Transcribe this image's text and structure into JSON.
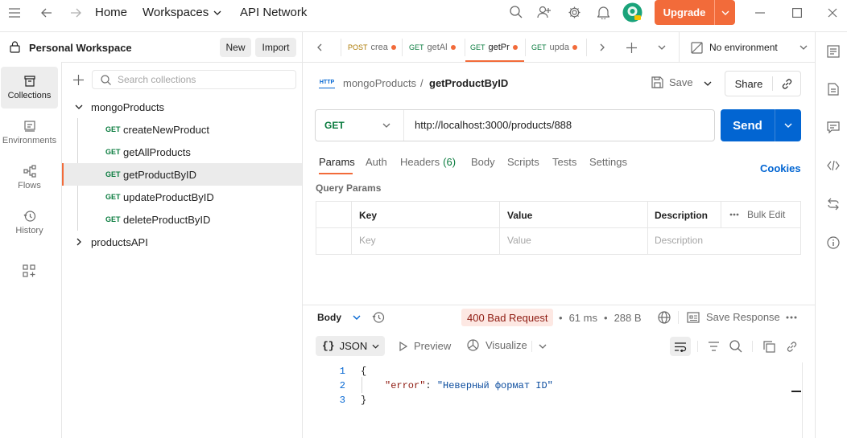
{
  "topbar": {
    "home": "Home",
    "workspaces": "Workspaces",
    "api_network": "API Network",
    "upgrade": "Upgrade"
  },
  "workspace": {
    "name": "Personal Workspace",
    "new": "New",
    "import": "Import"
  },
  "rail": [
    {
      "label": "Collections"
    },
    {
      "label": "Environments"
    },
    {
      "label": "Flows"
    },
    {
      "label": "History"
    }
  ],
  "sidebar": {
    "search_placeholder": "Search collections",
    "collections": [
      {
        "name": "mongoProducts"
      },
      {
        "name": "productsAPI"
      }
    ],
    "requests": [
      {
        "method": "GET",
        "name": "createNewProduct"
      },
      {
        "method": "GET",
        "name": "getAllProducts"
      },
      {
        "method": "GET",
        "name": "getProductByID"
      },
      {
        "method": "GET",
        "name": "updateProductByID"
      },
      {
        "method": "GET",
        "name": "deleteProductByID"
      }
    ]
  },
  "tabs": [
    {
      "method": "POST",
      "label": "crea"
    },
    {
      "method": "GET",
      "label": "getAl"
    },
    {
      "method": "GET",
      "label": "getPr"
    },
    {
      "method": "GET",
      "label": "upda"
    }
  ],
  "environment": "No environment",
  "request": {
    "breadcrumb_parent": "mongoProducts",
    "breadcrumb_sep": "/",
    "title": "getProductByID",
    "http_badge": "HTTP",
    "save": "Save",
    "share": "Share",
    "method": "GET",
    "url": "http://localhost:3000/products/888",
    "send": "Send"
  },
  "subtabs": {
    "params": "Params",
    "auth": "Auth",
    "headers": "Headers",
    "headers_count": "(6)",
    "body": "Body",
    "scripts": "Scripts",
    "tests": "Tests",
    "settings": "Settings",
    "cookies": "Cookies"
  },
  "query": {
    "title": "Query Params",
    "key": "Key",
    "value": "Value",
    "description": "Description",
    "bulk_edit": "Bulk Edit",
    "key_ph": "Key",
    "value_ph": "Value",
    "description_ph": "Description"
  },
  "response": {
    "body": "Body",
    "status": "400 Bad Request",
    "time": "61 ms",
    "size": "288 B",
    "save_response": "Save Response",
    "format": "JSON",
    "preview": "Preview",
    "visualize": "Visualize",
    "lines": [
      "1",
      "2",
      "3"
    ],
    "brace_open": "{",
    "brace_close": "}",
    "json_key": "\"error\"",
    "json_colon": ":",
    "json_value": "\"Неверный формат ID\""
  },
  "colors": {
    "accent": "#f26b3a",
    "send": "#0265d2",
    "method_get": "#097b3e",
    "status_bg": "#fde8e3",
    "status_fg": "#8e1a10"
  }
}
